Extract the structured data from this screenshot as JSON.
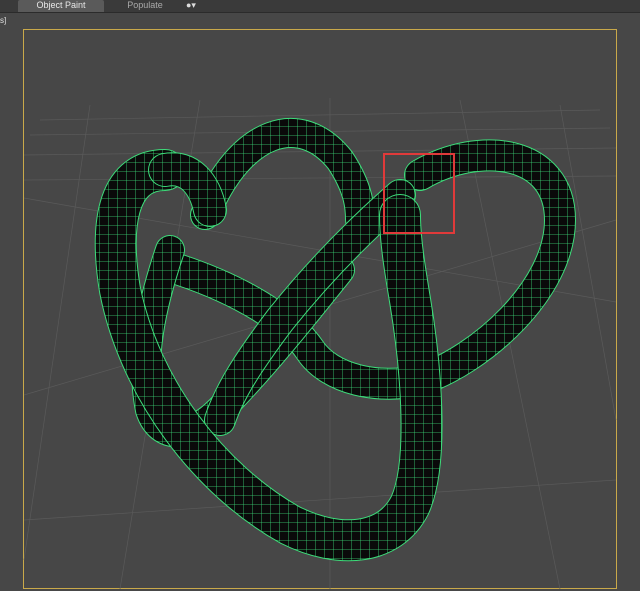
{
  "tabs": {
    "object_paint": "Object Paint",
    "populate": "Populate",
    "options_icon": "camera-dropdown-icon"
  },
  "viewport": {
    "label": "s]",
    "active_border_color": "#c9a94a",
    "mesh_color": "#3ddc7a",
    "selection_color": "#e03a3a"
  }
}
